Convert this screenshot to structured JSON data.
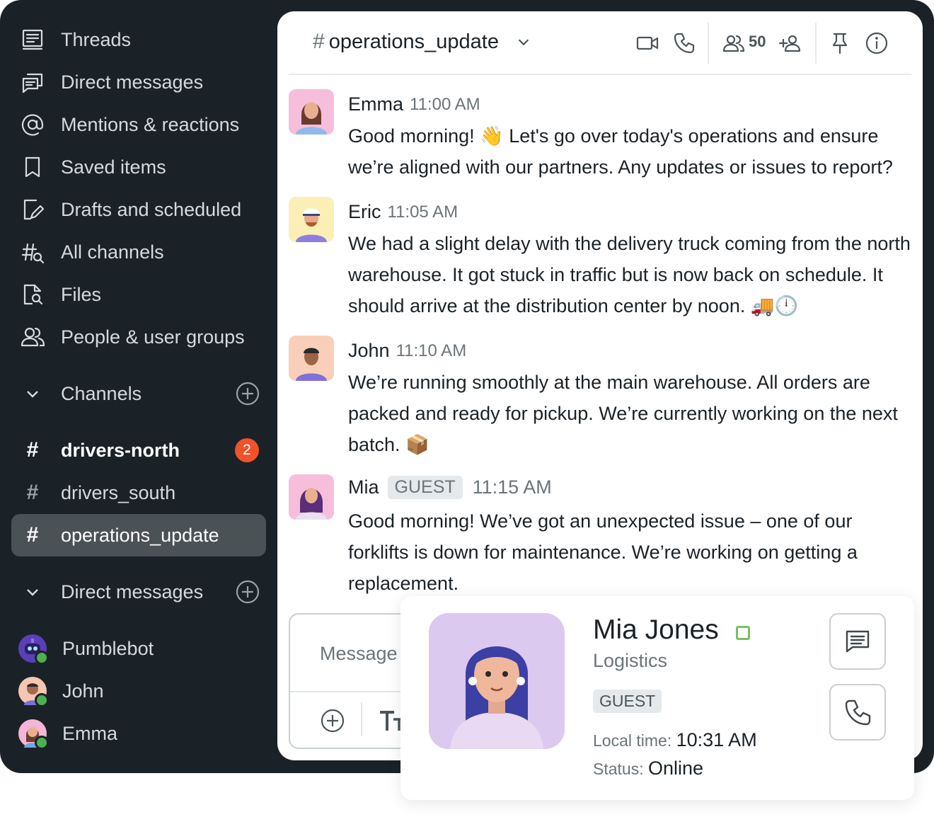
{
  "sidebar": {
    "nav": [
      {
        "label": "Threads",
        "icon": "threads-icon"
      },
      {
        "label": "Direct messages",
        "icon": "direct-messages-icon"
      },
      {
        "label": "Mentions & reactions",
        "icon": "at-sign-icon"
      },
      {
        "label": "Saved items",
        "icon": "bookmark-icon"
      },
      {
        "label": "Drafts and scheduled",
        "icon": "drafts-icon"
      },
      {
        "label": "All channels",
        "icon": "channel-search-icon"
      },
      {
        "label": "Files",
        "icon": "file-search-icon"
      },
      {
        "label": "People & user groups",
        "icon": "people-icon"
      }
    ],
    "channels_header": "Channels",
    "channels": [
      {
        "name": "drivers-north",
        "unread": "2"
      },
      {
        "name": "drivers_south"
      },
      {
        "name": "operations_update"
      }
    ],
    "dm_header": "Direct messages",
    "dms": [
      {
        "name": "Pumblebot"
      },
      {
        "name": "John"
      },
      {
        "name": "Emma"
      }
    ]
  },
  "channel": {
    "name": "operations_update",
    "member_count": "50"
  },
  "messages": [
    {
      "author": "Emma",
      "time": "11:00 AM",
      "text": "Good morning! 👋 Let's go over today's operations and ensure we’re aligned with our partners. Any updates or issues to report?"
    },
    {
      "author": "Eric",
      "time": "11:05 AM",
      "text": "We had a slight delay with the delivery truck coming from the north warehouse. It got stuck in traffic but is now back on schedule. It should arrive at the distribution center by noon. 🚚🕛"
    },
    {
      "author": "John",
      "time": "11:10 AM",
      "text": "We’re running smoothly at the main warehouse. All orders are packed and ready for pickup. We’re currently working on the next batch. 📦"
    },
    {
      "author": "Mia",
      "badge": "GUEST",
      "time": "11:15 AM",
      "text": "Good morning! We’ve got an unexpected issue – one of our forklifts is down for maintenance. We’re working on getting a replacement."
    }
  ],
  "composer": {
    "placeholder": "Message"
  },
  "profile_card": {
    "name": "Mia Jones",
    "department": "Logistics",
    "badge": "GUEST",
    "local_time_label": "Local time:",
    "local_time": "10:31 AM",
    "status_label": "Status:",
    "status": "Online"
  },
  "colors": {
    "sidebar_bg": "#1b2227",
    "active_channel_bg": "#4b5256",
    "unread_badge": "#f0522a",
    "online": "#4caf50"
  }
}
